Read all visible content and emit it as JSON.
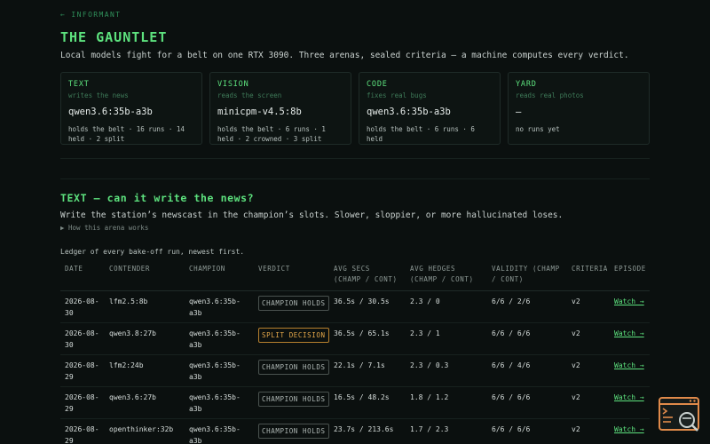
{
  "header": {
    "back_link": "← INFORMANT",
    "title": "THE GAUNTLET",
    "subtitle": "Local models fight for a belt on one RTX 3090. Three arenas, sealed criteria — a machine computes every verdict."
  },
  "arenas": [
    {
      "label": "TEXT",
      "desc": "writes the news",
      "champion": "qwen3.6:35b-a3b",
      "stats": "holds the belt · 16 runs · 14 held · 2 split"
    },
    {
      "label": "VISION",
      "desc": "reads the screen",
      "champion": "minicpm-v4.5:8b",
      "stats": "holds the belt · 6 runs · 1 held · 2 crowned · 3 split"
    },
    {
      "label": "CODE",
      "desc": "fixes real bugs",
      "champion": "qwen3.6:35b-a3b",
      "stats": "holds the belt · 6 runs · 6 held"
    },
    {
      "label": "YARD",
      "desc": "reads real photos",
      "champion": "—",
      "stats": "no runs yet"
    }
  ],
  "section": {
    "title": "TEXT — can it write the news?",
    "desc": "Write the station’s newscast in the champion’s slots. Slower, sloppier, or more hallucinated loses.",
    "details_toggle": "▶ How this arena works",
    "ledger_caption": "Ledger of every bake-off run, newest first."
  },
  "ledger": {
    "columns": [
      "DATE",
      "CONTENDER",
      "CHAMPION",
      "VERDICT",
      "AVG SECS (CHAMP / CONT)",
      "AVG HEDGES (CHAMP / CONT)",
      "VALIDITY (CHAMP / CONT)",
      "CRITERIA",
      "EPISODE"
    ],
    "rows": [
      {
        "date": "2026-08-30",
        "contender": "lfm2.5:8b",
        "champion": "qwen3.6:35b-a3b",
        "verdict": "CHAMPION HOLDS",
        "secs": "36.5s / 30.5s",
        "hedges": "2.3 / 0",
        "validity": "6/6 / 2/6",
        "criteria": "v2",
        "episode": "Watch →"
      },
      {
        "date": "2026-08-30",
        "contender": "qwen3.8:27b",
        "champion": "qwen3.6:35b-a3b",
        "verdict": "SPLIT DECISION",
        "secs": "36.5s / 65.1s",
        "hedges": "2.3 / 1",
        "validity": "6/6 / 6/6",
        "criteria": "v2",
        "episode": "Watch →"
      },
      {
        "date": "2026-08-29",
        "contender": "lfm2:24b",
        "champion": "qwen3.6:35b-a3b",
        "verdict": "CHAMPION HOLDS",
        "secs": "22.1s / 7.1s",
        "hedges": "2.3 / 0.3",
        "validity": "6/6 / 4/6",
        "criteria": "v2",
        "episode": "Watch →"
      },
      {
        "date": "2026-08-29",
        "contender": "qwen3.6:27b",
        "champion": "qwen3.6:35b-a3b",
        "verdict": "CHAMPION HOLDS",
        "secs": "16.5s / 48.2s",
        "hedges": "1.8 / 1.2",
        "validity": "6/6 / 6/6",
        "criteria": "v2",
        "episode": "Watch →"
      },
      {
        "date": "2026-08-29",
        "contender": "openthinker:32b",
        "champion": "qwen3.6:35b-a3b",
        "verdict": "CHAMPION HOLDS",
        "secs": "23.7s / 213.6s",
        "hedges": "1.7 / 2.3",
        "validity": "6/6 / 6/6",
        "criteria": "v2",
        "episode": "Watch →"
      }
    ]
  },
  "colors": {
    "accent": "#5de27e",
    "background": "#0b100f",
    "split_badge": "#e5a84a",
    "widget": "#e08a4a"
  },
  "icons": {
    "corner_widget": "terminal-search-icon"
  }
}
